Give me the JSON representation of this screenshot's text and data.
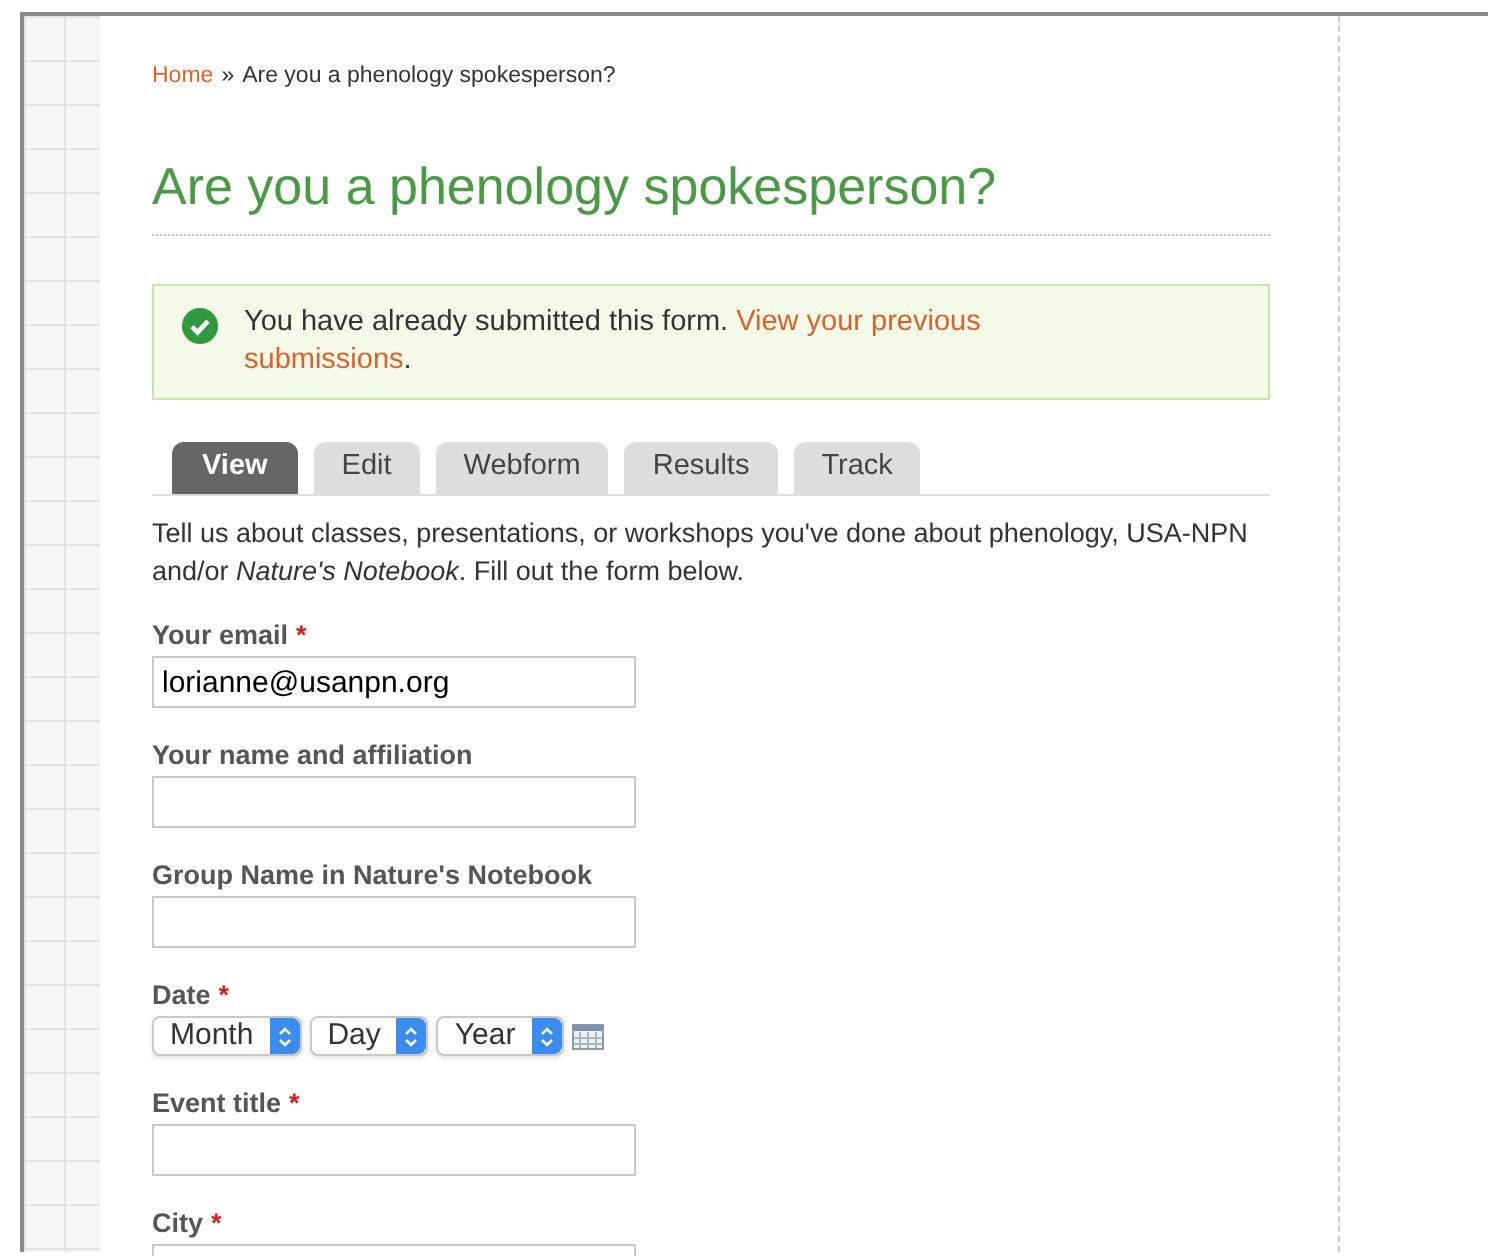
{
  "breadcrumb": {
    "home": "Home",
    "separator": "»",
    "current": "Are you a phenology spokesperson?"
  },
  "title": "Are you a phenology spokesperson?",
  "message": {
    "text": "You have already submitted this form.",
    "link_lines": [
      "View your previous",
      "submissions"
    ],
    "end": "."
  },
  "tabs": [
    {
      "label": "View",
      "selected": true
    },
    {
      "label": "Edit",
      "selected": false
    },
    {
      "label": "Webform",
      "selected": false
    },
    {
      "label": "Results",
      "selected": false
    },
    {
      "label": "Track",
      "selected": false
    }
  ],
  "intro": "Tell us about classes, presentations, or workshops you've done about phenology, USA-NPN and/or *Nature's Notebook*. Fill out the form below.",
  "fields": [
    {
      "kind": "text",
      "label": "Your email",
      "required_mark": "*",
      "value": "lorianne@usanpn.org"
    },
    {
      "kind": "text",
      "label": "Your name and affiliation"
    },
    {
      "kind": "text",
      "label": "Group Name in Nature's Notebook"
    },
    {
      "kind": "date",
      "label": "Date",
      "required_mark": "*",
      "selects": [
        "Month",
        "Day",
        "Year"
      ]
    },
    {
      "kind": "text",
      "label": "Event title",
      "required_mark": "*"
    },
    {
      "kind": "text",
      "label": "City",
      "required_mark": "*"
    }
  ]
}
